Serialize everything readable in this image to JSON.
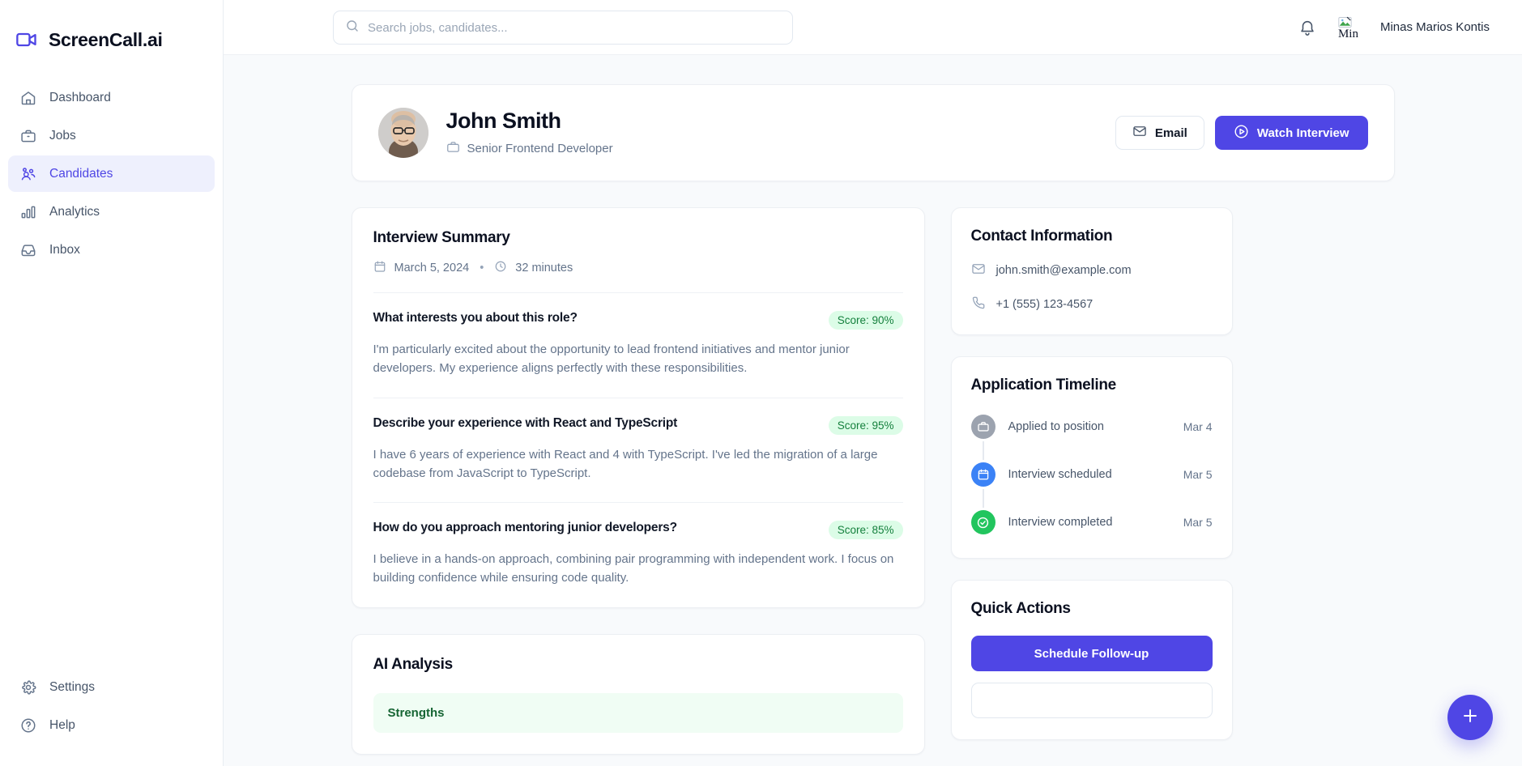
{
  "brand": {
    "name": "ScreenCall.ai",
    "logo_icon": "video-camera-icon",
    "accent": "#4f46e5"
  },
  "sidebar": {
    "items": [
      {
        "label": "Dashboard",
        "icon": "home-icon",
        "active": false
      },
      {
        "label": "Jobs",
        "icon": "briefcase-icon",
        "active": false
      },
      {
        "label": "Candidates",
        "icon": "users-icon",
        "active": true
      },
      {
        "label": "Analytics",
        "icon": "bar-chart-icon",
        "active": false
      },
      {
        "label": "Inbox",
        "icon": "inbox-icon",
        "active": false
      }
    ],
    "bottom_items": [
      {
        "label": "Settings",
        "icon": "gear-icon"
      },
      {
        "label": "Help",
        "icon": "question-circle-icon"
      }
    ]
  },
  "topbar": {
    "search": {
      "placeholder": "Search jobs, candidates...",
      "value": "",
      "icon": "search-icon"
    },
    "notifications_icon": "bell-icon",
    "user": {
      "name": "Minas Marios Kontis",
      "avatar_alt": "Min",
      "avatar_state": "broken-image"
    }
  },
  "candidate": {
    "name": "John Smith",
    "role": "Senior Frontend Developer",
    "role_icon": "briefcase-icon",
    "actions": [
      {
        "label": "Email",
        "icon": "envelope-icon",
        "style": "outline"
      },
      {
        "label": "Watch Interview",
        "icon": "play-circle-icon",
        "style": "primary"
      }
    ]
  },
  "interview_summary": {
    "title": "Interview Summary",
    "date": "March 5, 2024",
    "date_icon": "calendar-icon",
    "separator": "•",
    "duration": "32 minutes",
    "duration_icon": "clock-icon",
    "questions": [
      {
        "question": "What interests you about this role?",
        "score_label": "Score: 90%",
        "score": 90,
        "answer": "I'm particularly excited about the opportunity to lead frontend initiatives and mentor junior developers. My experience aligns perfectly with these responsibilities."
      },
      {
        "question": "Describe your experience with React and TypeScript",
        "score_label": "Score: 95%",
        "score": 95,
        "answer": "I have 6 years of experience with React and 4 with TypeScript. I've led the migration of a large codebase from JavaScript to TypeScript."
      },
      {
        "question": "How do you approach mentoring junior developers?",
        "score_label": "Score: 85%",
        "score": 85,
        "answer": "I believe in a hands-on approach, combining pair programming with independent work. I focus on building confidence while ensuring code quality."
      }
    ]
  },
  "ai_analysis": {
    "title": "AI Analysis",
    "strengths_label": "Strengths"
  },
  "contact_information": {
    "title": "Contact Information",
    "email": "john.smith@example.com",
    "email_icon": "envelope-icon",
    "phone": "+1 (555) 123-4567",
    "phone_icon": "phone-icon"
  },
  "application_timeline": {
    "title": "Application Timeline",
    "events": [
      {
        "label": "Applied to position",
        "date": "Mar 4",
        "icon": "briefcase-icon",
        "color": "#9ca3af"
      },
      {
        "label": "Interview scheduled",
        "date": "Mar 5",
        "icon": "calendar-icon",
        "color": "#3b82f6"
      },
      {
        "label": "Interview completed",
        "date": "Mar 5",
        "icon": "check-circle-icon",
        "color": "#22c55e"
      }
    ]
  },
  "quick_actions": {
    "title": "Quick Actions",
    "primary_label": "Schedule Follow-up"
  },
  "fab": {
    "icon": "plus-icon"
  }
}
